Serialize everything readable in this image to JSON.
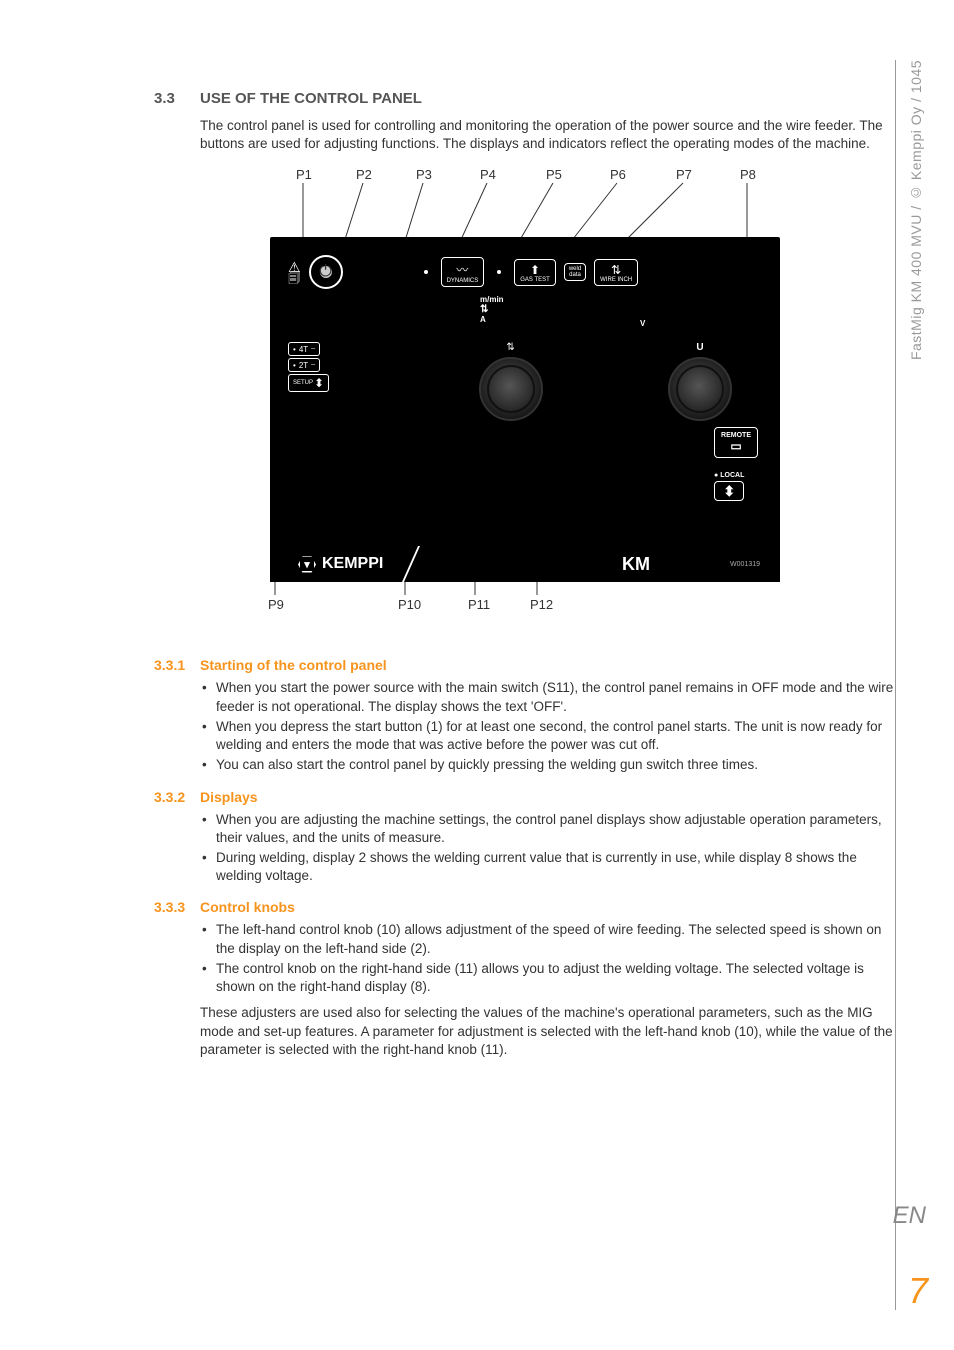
{
  "sidebar": {
    "doc_id": "FastMig KM 400 MVU / © Kemppi Oy / 1045",
    "lang": "EN",
    "page": "7"
  },
  "section": {
    "num": "3.3",
    "title": "USE OF THE CONTROL PANEL",
    "intro": "The control panel is used for controlling and monitoring the operation of the power source and the wire feeder. The buttons are used for adjusting functions. The displays and indicators reflect the operating modes of the machine."
  },
  "callouts": {
    "p1": "P1",
    "p2": "P2",
    "p3": "P3",
    "p4": "P4",
    "p5": "P5",
    "p6": "P6",
    "p7": "P7",
    "p8": "P8",
    "p9": "P9",
    "p10": "P10",
    "p11": "P11",
    "p12": "P12"
  },
  "panel": {
    "dynamics": "DYNAMICS",
    "gas_test": "GAS TEST",
    "weld_line1": "weld",
    "weld_line2": "data",
    "wire_inch": "WIRE INCH",
    "mmin": "m/min",
    "A": "A",
    "V": "V",
    "U": "U",
    "mode4t": "4T",
    "mode2t": "2T",
    "setup": "SETUP",
    "remote": "REMOTE",
    "local": "LOCAL",
    "brand": "KEMPPI",
    "km": "KM",
    "model_id": "W001319"
  },
  "sub1": {
    "num": "3.3.1",
    "title": "Starting of the control panel",
    "b1": "When you start the power source with the main switch (S11), the control panel remains in OFF mode and the wire feeder is not operational. The display shows the text 'OFF'.",
    "b2": "When you depress the start button (1) for at least one second, the control panel starts. The unit is now ready for welding and enters the mode that was active before the power was cut off.",
    "b3": "You can also start the control panel by quickly pressing the welding gun switch three times."
  },
  "sub2": {
    "num": "3.3.2",
    "title": "Displays",
    "b1": "When you are adjusting the machine settings, the control panel displays show adjustable operation parameters, their values, and the units of measure.",
    "b2": "During welding, display 2 shows the welding current value that is currently in use, while display 8 shows the welding voltage."
  },
  "sub3": {
    "num": "3.3.3",
    "title": "Control knobs",
    "b1": "The left-hand control knob (10) allows adjustment of the speed of wire feeding. The selected speed is shown on the display on the left-hand side (2).",
    "b2": "The control knob on the right-hand side (11) allows you to adjust the welding voltage. The selected voltage is shown on the right-hand display (8).",
    "para": "These adjusters are used also for selecting the values of the machine's operational parameters, such as the MIG mode and set-up features. A parameter for adjustment is selected with the left-hand knob (10), while the value of the parameter is selected with the right-hand knob (11)."
  }
}
